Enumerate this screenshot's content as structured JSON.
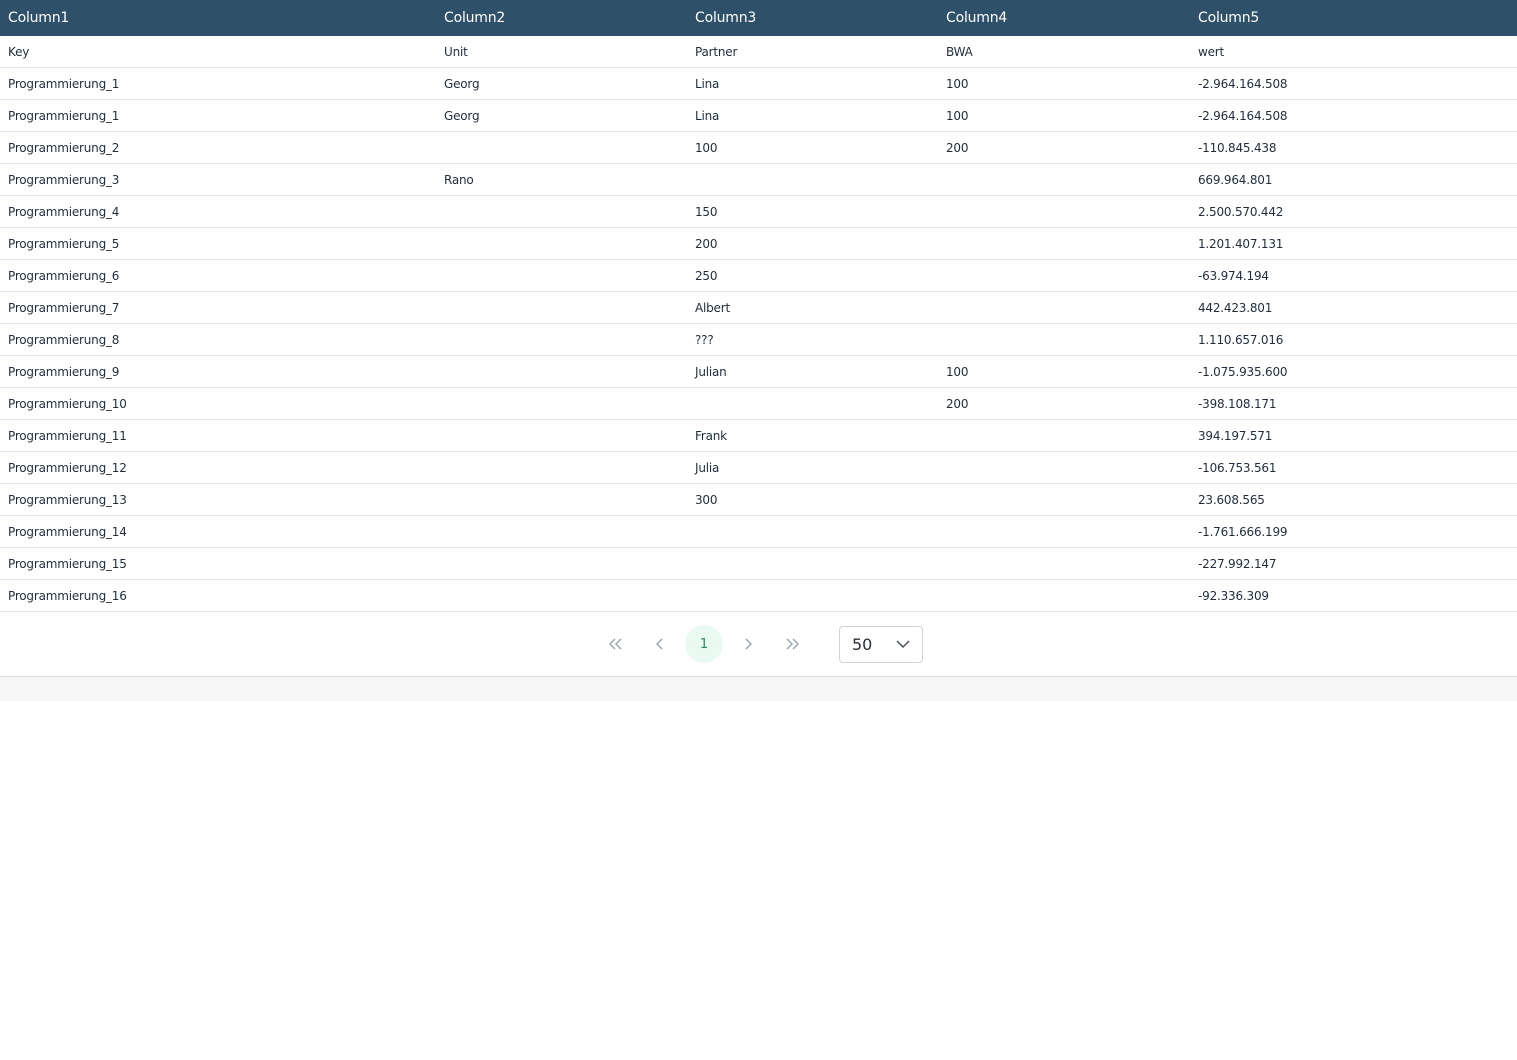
{
  "table": {
    "headers": [
      "Column1",
      "Column2",
      "Column3",
      "Column4",
      "Column5"
    ],
    "rows": [
      [
        "Key",
        "Unit",
        "Partner",
        "BWA",
        "wert"
      ],
      [
        "Programmierung_1",
        "Georg",
        "Lina",
        "100",
        "-2.964.164.508"
      ],
      [
        "Programmierung_1",
        "Georg",
        "Lina",
        "100",
        "-2.964.164.508"
      ],
      [
        "Programmierung_2",
        "",
        "100",
        "200",
        "-110.845.438"
      ],
      [
        "Programmierung_3",
        "Rano",
        "",
        "",
        "669.964.801"
      ],
      [
        "Programmierung_4",
        "",
        "150",
        "",
        "2.500.570.442"
      ],
      [
        "Programmierung_5",
        "",
        "200",
        "",
        "1.201.407.131"
      ],
      [
        "Programmierung_6",
        "",
        "250",
        "",
        "-63.974.194"
      ],
      [
        "Programmierung_7",
        "",
        "Albert",
        "",
        "442.423.801"
      ],
      [
        "Programmierung_8",
        "",
        "???",
        "",
        "1.110.657.016"
      ],
      [
        "Programmierung_9",
        "",
        "Julian",
        "100",
        "-1.075.935.600"
      ],
      [
        "Programmierung_10",
        "",
        "",
        "200",
        "-398.108.171"
      ],
      [
        "Programmierung_11",
        "",
        "Frank",
        "",
        "394.197.571"
      ],
      [
        "Programmierung_12",
        "",
        "Julia",
        "",
        "-106.753.561"
      ],
      [
        "Programmierung_13",
        "",
        "300",
        "",
        "23.608.565"
      ],
      [
        "Programmierung_14",
        "",
        "",
        "",
        "-1.761.666.199"
      ],
      [
        "Programmierung_15",
        "",
        "",
        "",
        "-227.992.147"
      ],
      [
        "Programmierung_16",
        "",
        "",
        "",
        "-92.336.309"
      ]
    ]
  },
  "pagination": {
    "first_icon": "double-chevron-left-icon",
    "prev_icon": "chevron-left-icon",
    "current_page": "1",
    "next_icon": "chevron-right-icon",
    "last_icon": "double-chevron-right-icon",
    "page_size": "50",
    "page_size_icon": "chevron-down-icon"
  },
  "colors": {
    "header_bg": "#2e5068",
    "header_text": "#ffffff",
    "active_page_bg": "#eafaf3",
    "active_page_text": "#2e8a62"
  }
}
